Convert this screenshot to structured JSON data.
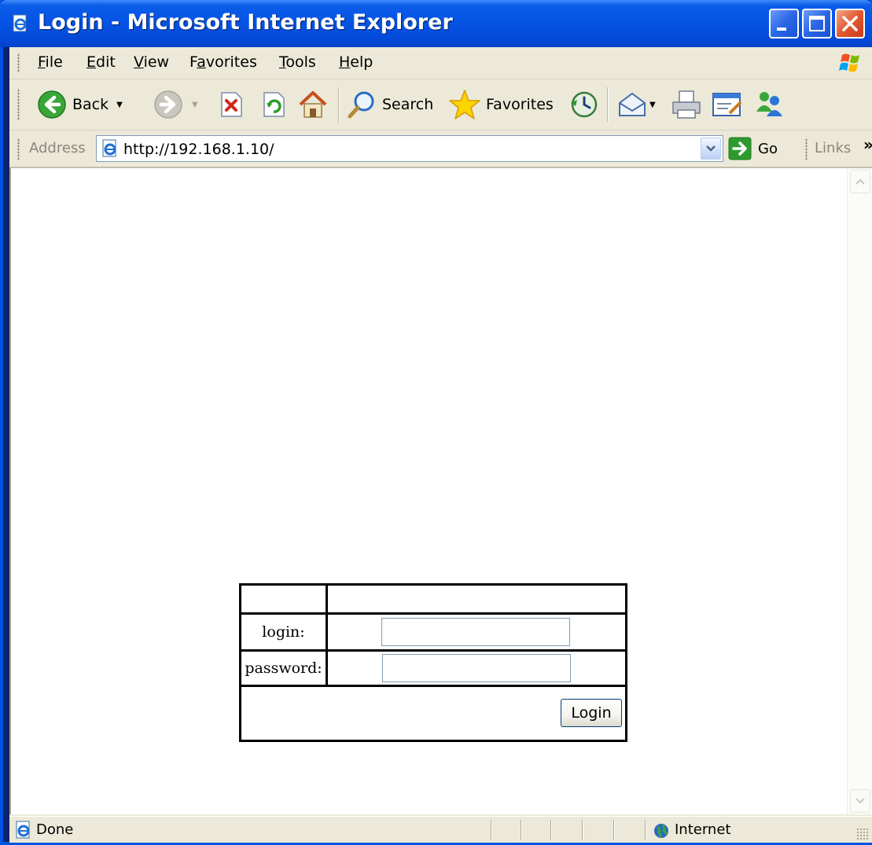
{
  "window": {
    "title": "Login - Microsoft Internet Explorer",
    "controls": {
      "minimize_icon": "minimize-icon",
      "maximize_icon": "maximize-icon",
      "close_icon": "close-icon"
    }
  },
  "menubar": {
    "items": [
      {
        "label": "File",
        "accel": "F"
      },
      {
        "label": "Edit",
        "accel": "E"
      },
      {
        "label": "View",
        "accel": "V"
      },
      {
        "label": "Favorites",
        "accel": "a"
      },
      {
        "label": "Tools",
        "accel": "T"
      },
      {
        "label": "Help",
        "accel": "H"
      }
    ]
  },
  "toolbar": {
    "back_label": "Back",
    "search_label": "Search",
    "favorites_label": "Favorites"
  },
  "addressbar": {
    "label": "Address",
    "url": "http://192.168.1.10/",
    "go_label": "Go",
    "links_label": "Links",
    "links_chevron": "»"
  },
  "login_form": {
    "login_label": "login:",
    "password_label": "password:",
    "login_value": "",
    "password_value": "",
    "submit_label": "Login"
  },
  "statusbar": {
    "text": "Done",
    "zone": "Internet"
  },
  "colors": {
    "titlebar": "#0553e4",
    "chrome": "#ece9d8",
    "close_button": "#e2592f",
    "input_border": "#7f9db9"
  }
}
